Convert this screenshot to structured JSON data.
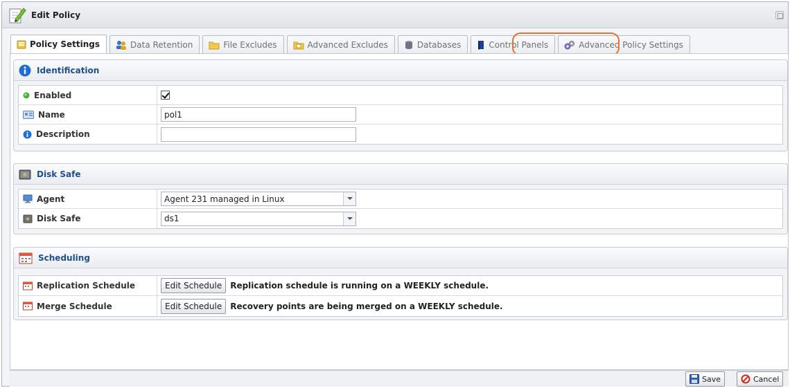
{
  "window": {
    "title": "Edit Policy"
  },
  "tabs": [
    {
      "label": "Policy Settings",
      "icon": "policy-icon"
    },
    {
      "label": "Data Retention",
      "icon": "users-icon"
    },
    {
      "label": "File Excludes",
      "icon": "folder-icon"
    },
    {
      "label": "Advanced Excludes",
      "icon": "folder-icon"
    },
    {
      "label": "Databases",
      "icon": "database-icon"
    },
    {
      "label": "Control Panels",
      "icon": "book-icon"
    },
    {
      "label": "Advanced Policy Settings",
      "icon": "gears-icon"
    }
  ],
  "identification": {
    "title": "Identification",
    "enabled_label": "Enabled",
    "name_label": "Name",
    "name_value": "pol1",
    "description_label": "Description",
    "description_value": ""
  },
  "disk_safe": {
    "title": "Disk Safe",
    "agent_label": "Agent",
    "agent_value": "Agent 231 managed in Linux",
    "disk_safe_label": "Disk Safe",
    "disk_safe_value": "ds1"
  },
  "scheduling": {
    "title": "Scheduling",
    "replication_label": "Replication Schedule",
    "replication_button": "Edit Schedule",
    "replication_text": "Replication schedule is running on a WEEKLY schedule.",
    "merge_label": "Merge Schedule",
    "merge_button": "Edit Schedule",
    "merge_text": "Recovery points are being merged on a WEEKLY schedule."
  },
  "footer": {
    "save_label": "Save",
    "cancel_label": "Cancel"
  },
  "colors": {
    "accent": "#1f4f8a",
    "highlight": "#e6702e"
  }
}
